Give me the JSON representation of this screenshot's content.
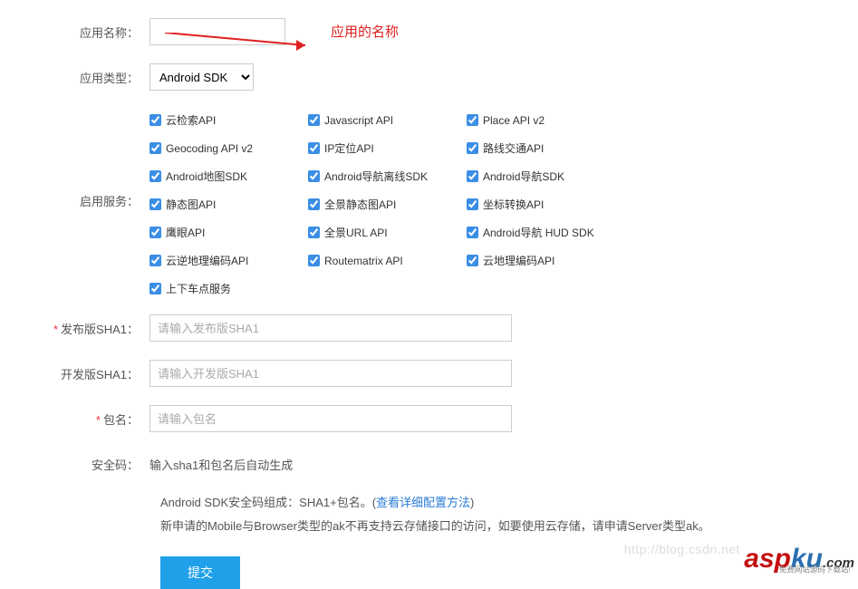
{
  "labels": {
    "appName": "应用名称：",
    "appType": "应用类型：",
    "services": "启用服务：",
    "releaseSha1": "发布版SHA1：",
    "devSha1": "开发版SHA1：",
    "packageName": "包名：",
    "securityCode": "安全码："
  },
  "appType": {
    "selected": "Android SDK"
  },
  "annotation": "应用的名称",
  "services": [
    {
      "label": "云检索API",
      "checked": true
    },
    {
      "label": "Javascript API",
      "checked": true
    },
    {
      "label": "Place API v2",
      "checked": true
    },
    {
      "label": "Geocoding API v2",
      "checked": true
    },
    {
      "label": "IP定位API",
      "checked": true
    },
    {
      "label": "路线交通API",
      "checked": true
    },
    {
      "label": "Android地图SDK",
      "checked": true
    },
    {
      "label": "Android导航离线SDK",
      "checked": true
    },
    {
      "label": "Android导航SDK",
      "checked": true
    },
    {
      "label": "静态图API",
      "checked": true
    },
    {
      "label": "全景静态图API",
      "checked": true
    },
    {
      "label": "坐标转换API",
      "checked": true
    },
    {
      "label": "鹰眼API",
      "checked": true
    },
    {
      "label": "全景URL API",
      "checked": true
    },
    {
      "label": "Android导航 HUD SDK",
      "checked": true
    },
    {
      "label": "云逆地理编码API",
      "checked": true
    },
    {
      "label": "Routematrix API",
      "checked": true
    },
    {
      "label": "云地理编码API",
      "checked": true
    },
    {
      "label": "上下车点服务",
      "checked": true
    }
  ],
  "placeholders": {
    "releaseSha1": "请输入发布版SHA1",
    "devSha1": "请输入开发版SHA1",
    "packageName": "请输入包名"
  },
  "securityCodeHint": "输入sha1和包名后自动生成",
  "notes": {
    "line1a": "Android SDK安全码组成：SHA1+包名。(",
    "link": "查看详细配置方法",
    "line1b": ")",
    "line2": "新申请的Mobile与Browser类型的ak不再支持云存储接口的访问，如要使用云存储，请申请Server类型ak。"
  },
  "submitLabel": "提交",
  "watermark": "http://blog.csdn.net",
  "logo": {
    "asp": "asp",
    "ku": "ku",
    "com": ".com",
    "sub": "免费网站源码下载站!"
  }
}
